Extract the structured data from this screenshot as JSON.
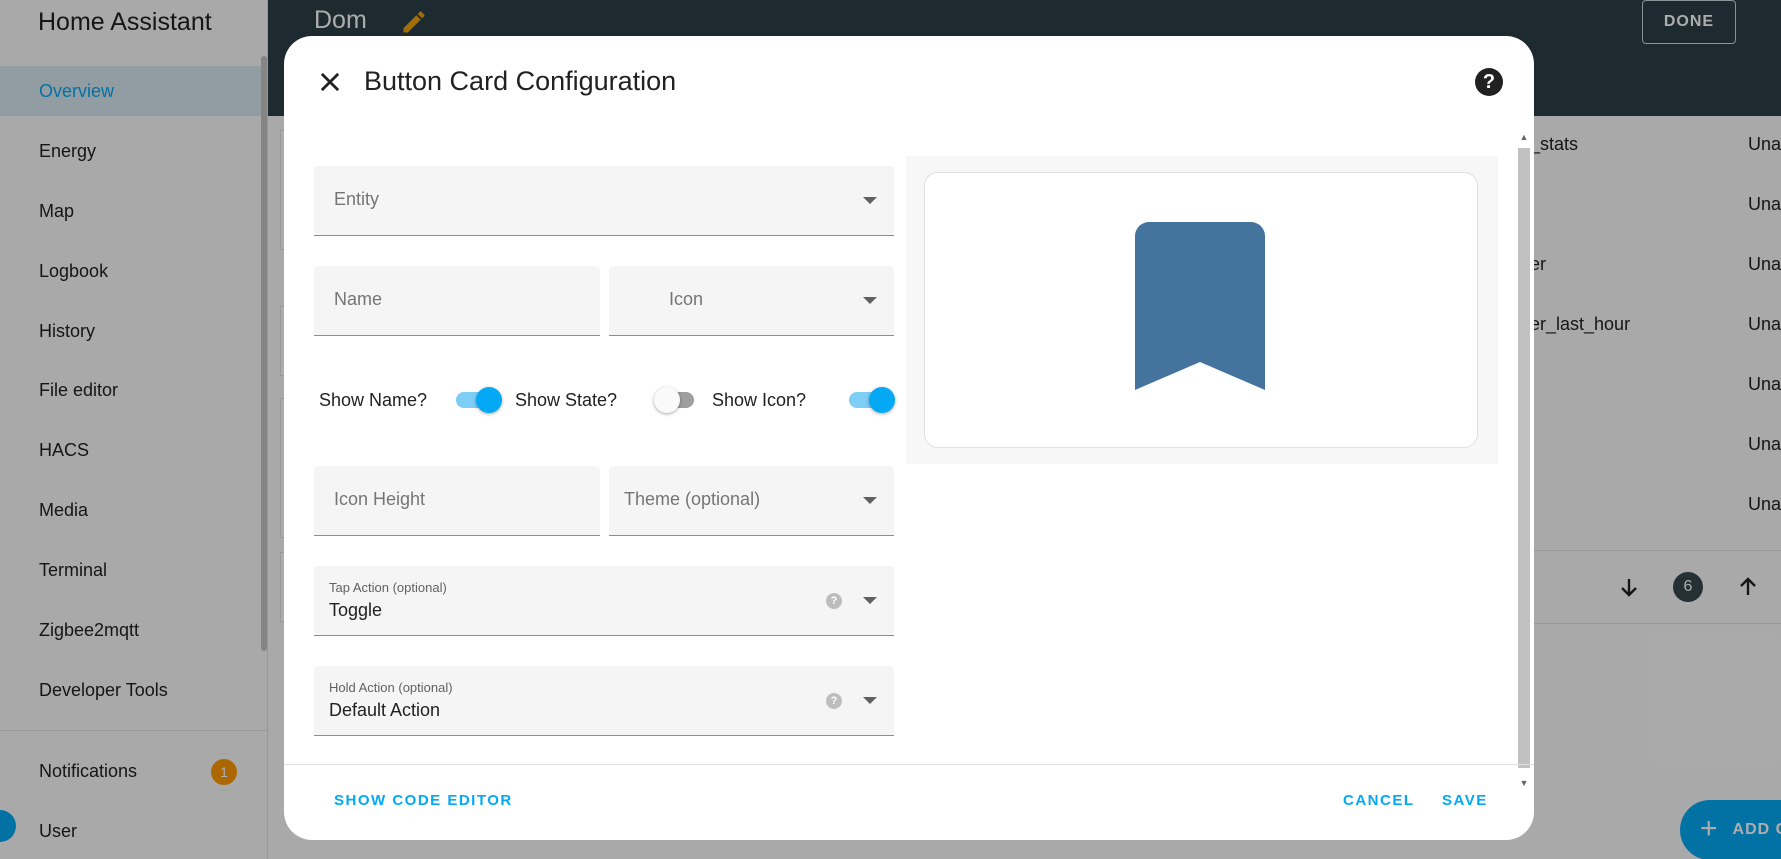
{
  "sidebar": {
    "title": "Home Assistant",
    "items": [
      {
        "label": "Overview",
        "active": true
      },
      {
        "label": "Energy"
      },
      {
        "label": "Map"
      },
      {
        "label": "Logbook"
      },
      {
        "label": "History"
      },
      {
        "label": "File editor"
      },
      {
        "label": "HACS"
      },
      {
        "label": "Media"
      },
      {
        "label": "Terminal"
      },
      {
        "label": "Zigbee2mqtt"
      },
      {
        "label": "Developer Tools"
      }
    ],
    "notifications": {
      "label": "Notifications",
      "count": "1"
    },
    "user": {
      "label": "User"
    }
  },
  "header": {
    "title": "Dom",
    "done_label": "DONE",
    "edit_icon": "pencil-icon"
  },
  "background": {
    "rows": [
      "_stats",
      "",
      "er",
      "er_last_hour",
      "",
      "",
      ""
    ],
    "states": [
      "Una",
      "Una",
      "Una",
      "Una",
      "Una",
      "Una",
      "Una"
    ],
    "position_badge": "6",
    "fab_label": "ADD C"
  },
  "dialog": {
    "title": "Button Card Configuration",
    "fields": {
      "entity": {
        "label": "Entity"
      },
      "name": {
        "label": "Name"
      },
      "icon": {
        "label": "Icon"
      },
      "icon_height": {
        "label": "Icon Height"
      },
      "theme": {
        "label": "Theme (optional)"
      },
      "tap_action": {
        "label": "Tap Action (optional)",
        "value": "Toggle"
      },
      "hold_action": {
        "label": "Hold Action (optional)",
        "value": "Default Action"
      }
    },
    "toggles": [
      {
        "label": "Show Name?",
        "on": true
      },
      {
        "label": "Show State?",
        "on": false
      },
      {
        "label": "Show Icon?",
        "on": true
      }
    ],
    "footer": {
      "code_editor": "SHOW CODE EDITOR",
      "cancel": "CANCEL",
      "save": "SAVE"
    }
  },
  "colors": {
    "accent": "#03a9f4",
    "header": "#2c3e48",
    "preview_icon": "#44739e",
    "badge": "#ff9800"
  }
}
